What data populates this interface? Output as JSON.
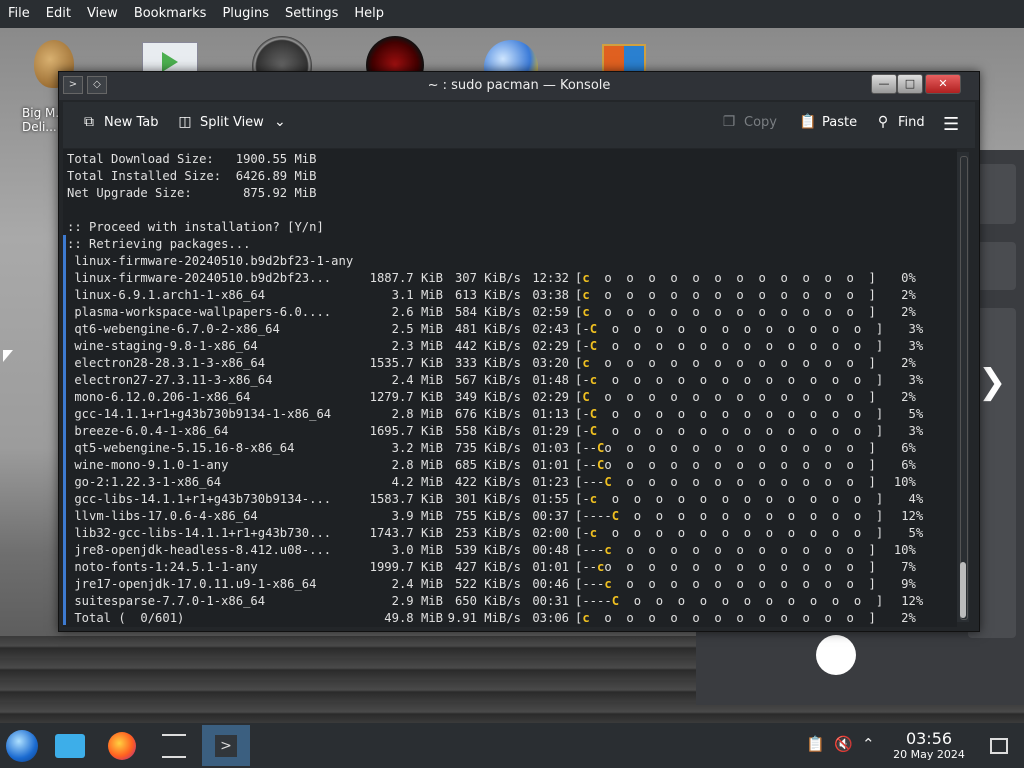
{
  "menubar": [
    "File",
    "Edit",
    "View",
    "Bookmarks",
    "Plugins",
    "Settings",
    "Help"
  ],
  "desktop": {
    "money_icon_label": "Big M... Deli..."
  },
  "window": {
    "title": "~ : sudo pacman — Konsole"
  },
  "toolbar": {
    "new_tab": "New Tab",
    "split_view": "Split View",
    "copy": "Copy",
    "paste": "Paste",
    "find": "Find"
  },
  "terminal": {
    "header_lines": [
      "Total Download Size:   1900.55 MiB",
      "Total Installed Size:  6426.89 MiB",
      "Net Upgrade Size:       875.92 MiB",
      "",
      ":: Proceed with installation? [Y/n]",
      ":: Retrieving packages...",
      " linux-firmware-20240510.b9d2bf23-1-any"
    ],
    "rows": [
      {
        "name": " linux-firmware-20240510.b9d2bf23...",
        "size": "1887.7 KiB",
        "rate": "307 KiB/s",
        "eta": "12:32",
        "pre": "",
        "pac": "c",
        "post": "  o  o  o  o  o  o  o  o  o  o  o  o",
        "pct": "0%"
      },
      {
        "name": " linux-6.9.1.arch1-1-x86_64",
        "size": "3.1 MiB",
        "rate": "613 KiB/s",
        "eta": "03:38",
        "pre": "",
        "pac": "c",
        "post": "  o  o  o  o  o  o  o  o  o  o  o  o",
        "pct": "2%"
      },
      {
        "name": " plasma-workspace-wallpapers-6.0....",
        "size": "2.6 MiB",
        "rate": "584 KiB/s",
        "eta": "02:59",
        "pre": "",
        "pac": "c",
        "post": "  o  o  o  o  o  o  o  o  o  o  o  o",
        "pct": "2%"
      },
      {
        "name": " qt6-webengine-6.7.0-2-x86_64",
        "size": "2.5 MiB",
        "rate": "481 KiB/s",
        "eta": "02:43",
        "pre": "-",
        "pac": "C",
        "post": "  o  o  o  o  o  o  o  o  o  o  o  o",
        "pct": "3%"
      },
      {
        "name": " wine-staging-9.8-1-x86_64",
        "size": "2.3 MiB",
        "rate": "442 KiB/s",
        "eta": "02:29",
        "pre": "-",
        "pac": "C",
        "post": "  o  o  o  o  o  o  o  o  o  o  o  o",
        "pct": "3%"
      },
      {
        "name": " electron28-28.3.1-3-x86_64",
        "size": "1535.7 KiB",
        "rate": "333 KiB/s",
        "eta": "03:20",
        "pre": "",
        "pac": "c",
        "post": "  o  o  o  o  o  o  o  o  o  o  o  o",
        "pct": "2%"
      },
      {
        "name": " electron27-27.3.11-3-x86_64",
        "size": "2.4 MiB",
        "rate": "567 KiB/s",
        "eta": "01:48",
        "pre": "-",
        "pac": "c",
        "post": "  o  o  o  o  o  o  o  o  o  o  o  o",
        "pct": "3%"
      },
      {
        "name": " mono-6.12.0.206-1-x86_64",
        "size": "1279.7 KiB",
        "rate": "349 KiB/s",
        "eta": "02:29",
        "pre": "",
        "pac": "C",
        "post": "  o  o  o  o  o  o  o  o  o  o  o  o",
        "pct": "2%"
      },
      {
        "name": " gcc-14.1.1+r1+g43b730b9134-1-x86_64",
        "size": "2.8 MiB",
        "rate": "676 KiB/s",
        "eta": "01:13",
        "pre": "-",
        "pac": "C",
        "post": "  o  o  o  o  o  o  o  o  o  o  o  o",
        "pct": "5%"
      },
      {
        "name": " breeze-6.0.4-1-x86_64",
        "size": "1695.7 KiB",
        "rate": "558 KiB/s",
        "eta": "01:29",
        "pre": "-",
        "pac": "C",
        "post": "  o  o  o  o  o  o  o  o  o  o  o  o",
        "pct": "3%"
      },
      {
        "name": " qt5-webengine-5.15.16-8-x86_64",
        "size": "3.2 MiB",
        "rate": "735 KiB/s",
        "eta": "01:03",
        "pre": "--",
        "pac": "C",
        "post": "o  o  o  o  o  o  o  o  o  o  o  o",
        "pct": "6%"
      },
      {
        "name": " wine-mono-9.1.0-1-any",
        "size": "2.8 MiB",
        "rate": "685 KiB/s",
        "eta": "01:01",
        "pre": "--",
        "pac": "C",
        "post": "o  o  o  o  o  o  o  o  o  o  o  o",
        "pct": "6%"
      },
      {
        "name": " go-2:1.22.3-1-x86_64",
        "size": "4.2 MiB",
        "rate": "422 KiB/s",
        "eta": "01:23",
        "pre": "---",
        "pac": "C",
        "post": "  o  o  o  o  o  o  o  o  o  o  o",
        "pct": "10%"
      },
      {
        "name": " gcc-libs-14.1.1+r1+g43b730b9134-...",
        "size": "1583.7 KiB",
        "rate": "301 KiB/s",
        "eta": "01:55",
        "pre": "-",
        "pac": "c",
        "post": "  o  o  o  o  o  o  o  o  o  o  o  o",
        "pct": "4%"
      },
      {
        "name": " llvm-libs-17.0.6-4-x86_64",
        "size": "3.9 MiB",
        "rate": "755 KiB/s",
        "eta": "00:37",
        "pre": "----",
        "pac": "C",
        "post": "  o  o  o  o  o  o  o  o  o  o  o",
        "pct": "12%"
      },
      {
        "name": " lib32-gcc-libs-14.1.1+r1+g43b730...",
        "size": "1743.7 KiB",
        "rate": "253 KiB/s",
        "eta": "02:00",
        "pre": "-",
        "pac": "c",
        "post": "  o  o  o  o  o  o  o  o  o  o  o  o",
        "pct": "5%"
      },
      {
        "name": " jre8-openjdk-headless-8.412.u08-...",
        "size": "3.0 MiB",
        "rate": "539 KiB/s",
        "eta": "00:48",
        "pre": "---",
        "pac": "c",
        "post": "  o  o  o  o  o  o  o  o  o  o  o",
        "pct": "10%"
      },
      {
        "name": " noto-fonts-1:24.5.1-1-any",
        "size": "1999.7 KiB",
        "rate": "427 KiB/s",
        "eta": "01:01",
        "pre": "--",
        "pac": "c",
        "post": "o  o  o  o  o  o  o  o  o  o  o  o",
        "pct": "7%"
      },
      {
        "name": " jre17-openjdk-17.0.11.u9-1-x86_64",
        "size": "2.4 MiB",
        "rate": "522 KiB/s",
        "eta": "00:46",
        "pre": "---",
        "pac": "c",
        "post": "  o  o  o  o  o  o  o  o  o  o  o",
        "pct": "9%"
      },
      {
        "name": " suitesparse-7.7.0-1-x86_64",
        "size": "2.9 MiB",
        "rate": "650 KiB/s",
        "eta": "00:31",
        "pre": "----",
        "pac": "C",
        "post": "  o  o  o  o  o  o  o  o  o  o  o",
        "pct": "12%"
      },
      {
        "name": " Total (  0/601)",
        "size": "49.8 MiB",
        "rate": "9.91 MiB/s",
        "eta": "03:06",
        "pre": "",
        "pac": "c",
        "post": "  o  o  o  o  o  o  o  o  o  o  o  o",
        "pct": "2%"
      }
    ]
  },
  "clock": {
    "time": "03:56",
    "date": "20 May 2024"
  },
  "colors": {
    "pacman": "#f0c020",
    "terminal_bg": "#1e2124",
    "accent": "#3daee9"
  }
}
